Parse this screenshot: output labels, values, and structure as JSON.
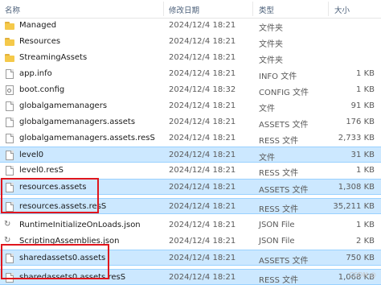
{
  "columns": {
    "name": "名称",
    "date": "修改日期",
    "type": "类型",
    "size": "大小"
  },
  "rows": [
    {
      "name": "Managed",
      "date": "2024/12/4 18:21",
      "type": "文件夹",
      "size": "",
      "icon": "folder-icon",
      "selected": false
    },
    {
      "name": "Resources",
      "date": "2024/12/4 18:21",
      "type": "文件夹",
      "size": "",
      "icon": "folder-icon",
      "selected": false
    },
    {
      "name": "StreamingAssets",
      "date": "2024/12/4 18:21",
      "type": "文件夹",
      "size": "",
      "icon": "folder-icon",
      "selected": false
    },
    {
      "name": "app.info",
      "date": "2024/12/4 18:21",
      "type": "INFO 文件",
      "size": "1 KB",
      "icon": "file-icon",
      "selected": false
    },
    {
      "name": "boot.config",
      "date": "2024/12/4 18:32",
      "type": "CONFIG 文件",
      "size": "1 KB",
      "icon": "config-file-icon",
      "selected": false
    },
    {
      "name": "globalgamemanagers",
      "date": "2024/12/4 18:21",
      "type": "文件",
      "size": "91 KB",
      "icon": "file-icon",
      "selected": false
    },
    {
      "name": "globalgamemanagers.assets",
      "date": "2024/12/4 18:21",
      "type": "ASSETS 文件",
      "size": "176 KB",
      "icon": "file-icon",
      "selected": false
    },
    {
      "name": "globalgamemanagers.assets.resS",
      "date": "2024/12/4 18:21",
      "type": "RESS 文件",
      "size": "2,733 KB",
      "icon": "file-icon",
      "selected": false
    },
    {
      "name": "level0",
      "date": "2024/12/4 18:21",
      "type": "文件",
      "size": "31 KB",
      "icon": "file-icon",
      "selected": true
    },
    {
      "name": "level0.resS",
      "date": "2024/12/4 18:21",
      "type": "RESS 文件",
      "size": "1 KB",
      "icon": "file-icon",
      "selected": false
    },
    {
      "name": "resources.assets",
      "date": "2024/12/4 18:21",
      "type": "ASSETS 文件",
      "size": "1,308 KB",
      "icon": "file-icon",
      "selected": true
    },
    {
      "name": "resources.assets.resS",
      "date": "2024/12/4 18:21",
      "type": "RESS 文件",
      "size": "35,211 KB",
      "icon": "file-icon",
      "selected": true
    },
    {
      "name": "RuntimeInitializeOnLoads.json",
      "date": "2024/12/4 18:21",
      "type": "JSON File",
      "size": "1 KB",
      "icon": "json-file-icon",
      "selected": false
    },
    {
      "name": "ScriptingAssemblies.json",
      "date": "2024/12/4 18:21",
      "type": "JSON File",
      "size": "2 KB",
      "icon": "json-file-icon",
      "selected": false
    },
    {
      "name": "sharedassets0.assets",
      "date": "2024/12/4 18:21",
      "type": "ASSETS 文件",
      "size": "750 KB",
      "icon": "file-icon",
      "selected": true
    },
    {
      "name": "sharedassets0.assets.resS",
      "date": "2024/12/4 18:21",
      "type": "RESS 文件",
      "size": "1,068 KB",
      "icon": "file-icon",
      "selected": true
    }
  ],
  "highlight_color": "#e0161d",
  "selection_color": "#cce8ff",
  "watermark": "CSDN @"
}
